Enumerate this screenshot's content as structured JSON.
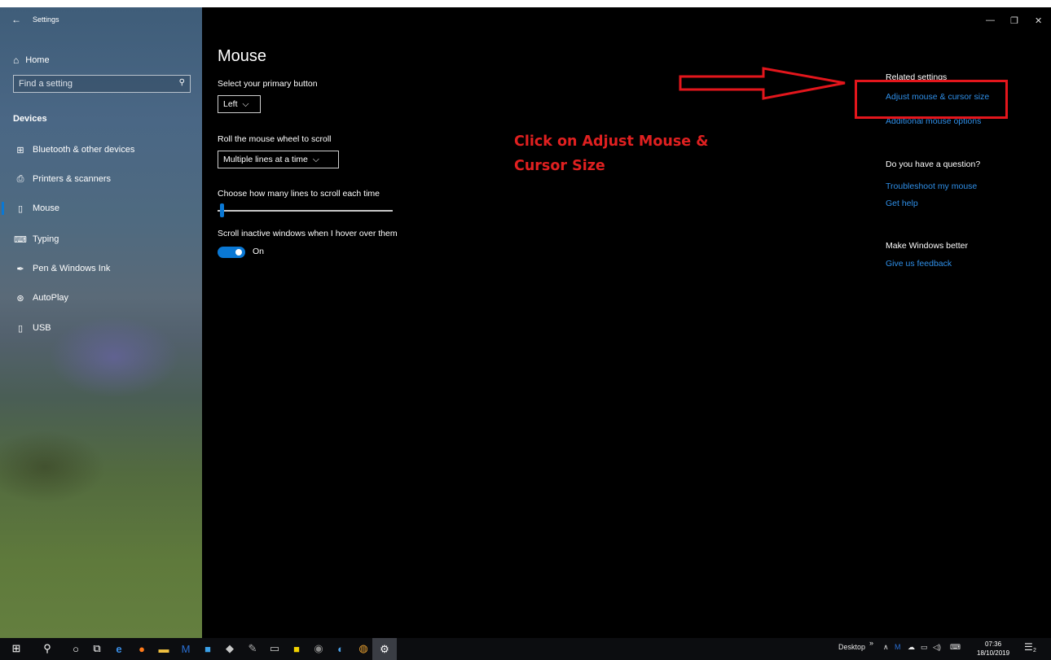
{
  "window": {
    "title": "Settings",
    "back_glyph": "←",
    "minimize_glyph": "—",
    "restore_glyph": "❐",
    "close_glyph": "✕"
  },
  "sidebar": {
    "home_label": "Home",
    "search_placeholder": "Find a setting",
    "section_label": "Devices",
    "items": [
      {
        "label": "Bluetooth & other devices",
        "icon": "bluetooth-devices-icon",
        "glyph": "⊞"
      },
      {
        "label": "Printers & scanners",
        "icon": "printer-icon",
        "glyph": "⎙"
      },
      {
        "label": "Mouse",
        "icon": "mouse-icon",
        "glyph": "▯",
        "selected": true
      },
      {
        "label": "Typing",
        "icon": "keyboard-icon",
        "glyph": "⌨"
      },
      {
        "label": "Pen & Windows Ink",
        "icon": "pen-icon",
        "glyph": "✒"
      },
      {
        "label": "AutoPlay",
        "icon": "autoplay-icon",
        "glyph": "⊛"
      },
      {
        "label": "USB",
        "icon": "usb-icon",
        "glyph": "▯"
      }
    ]
  },
  "main": {
    "title": "Mouse",
    "primary_button": {
      "label": "Select your primary button",
      "value": "Left"
    },
    "scroll_wheel": {
      "label": "Roll the mouse wheel to scroll",
      "value": "Multiple lines at a time"
    },
    "lines_to_scroll": {
      "label": "Choose how many lines to scroll each time",
      "value_fraction": 0.02
    },
    "inactive_scroll": {
      "label": "Scroll inactive windows when I hover over them",
      "state": "On"
    }
  },
  "annotation": {
    "line1": "Click on Adjust Mouse &",
    "line2": "Cursor Size",
    "color": "#e02020"
  },
  "related": {
    "heading": "Related settings",
    "links": [
      "Adjust mouse & cursor size",
      "Additional mouse options"
    ],
    "question_heading": "Do you have a question?",
    "question_links": [
      "Troubleshoot my mouse",
      "Get help"
    ],
    "better_heading": "Make Windows better",
    "better_link": "Give us feedback"
  },
  "taskbar": {
    "desktop_label": "Desktop",
    "chevron": "»",
    "time": "07:36",
    "date": "18/10/2019",
    "notification_count": "2"
  },
  "colors": {
    "accent": "#0a78d4",
    "link": "#2f8fe8",
    "highlight_box": "#e3161c"
  }
}
